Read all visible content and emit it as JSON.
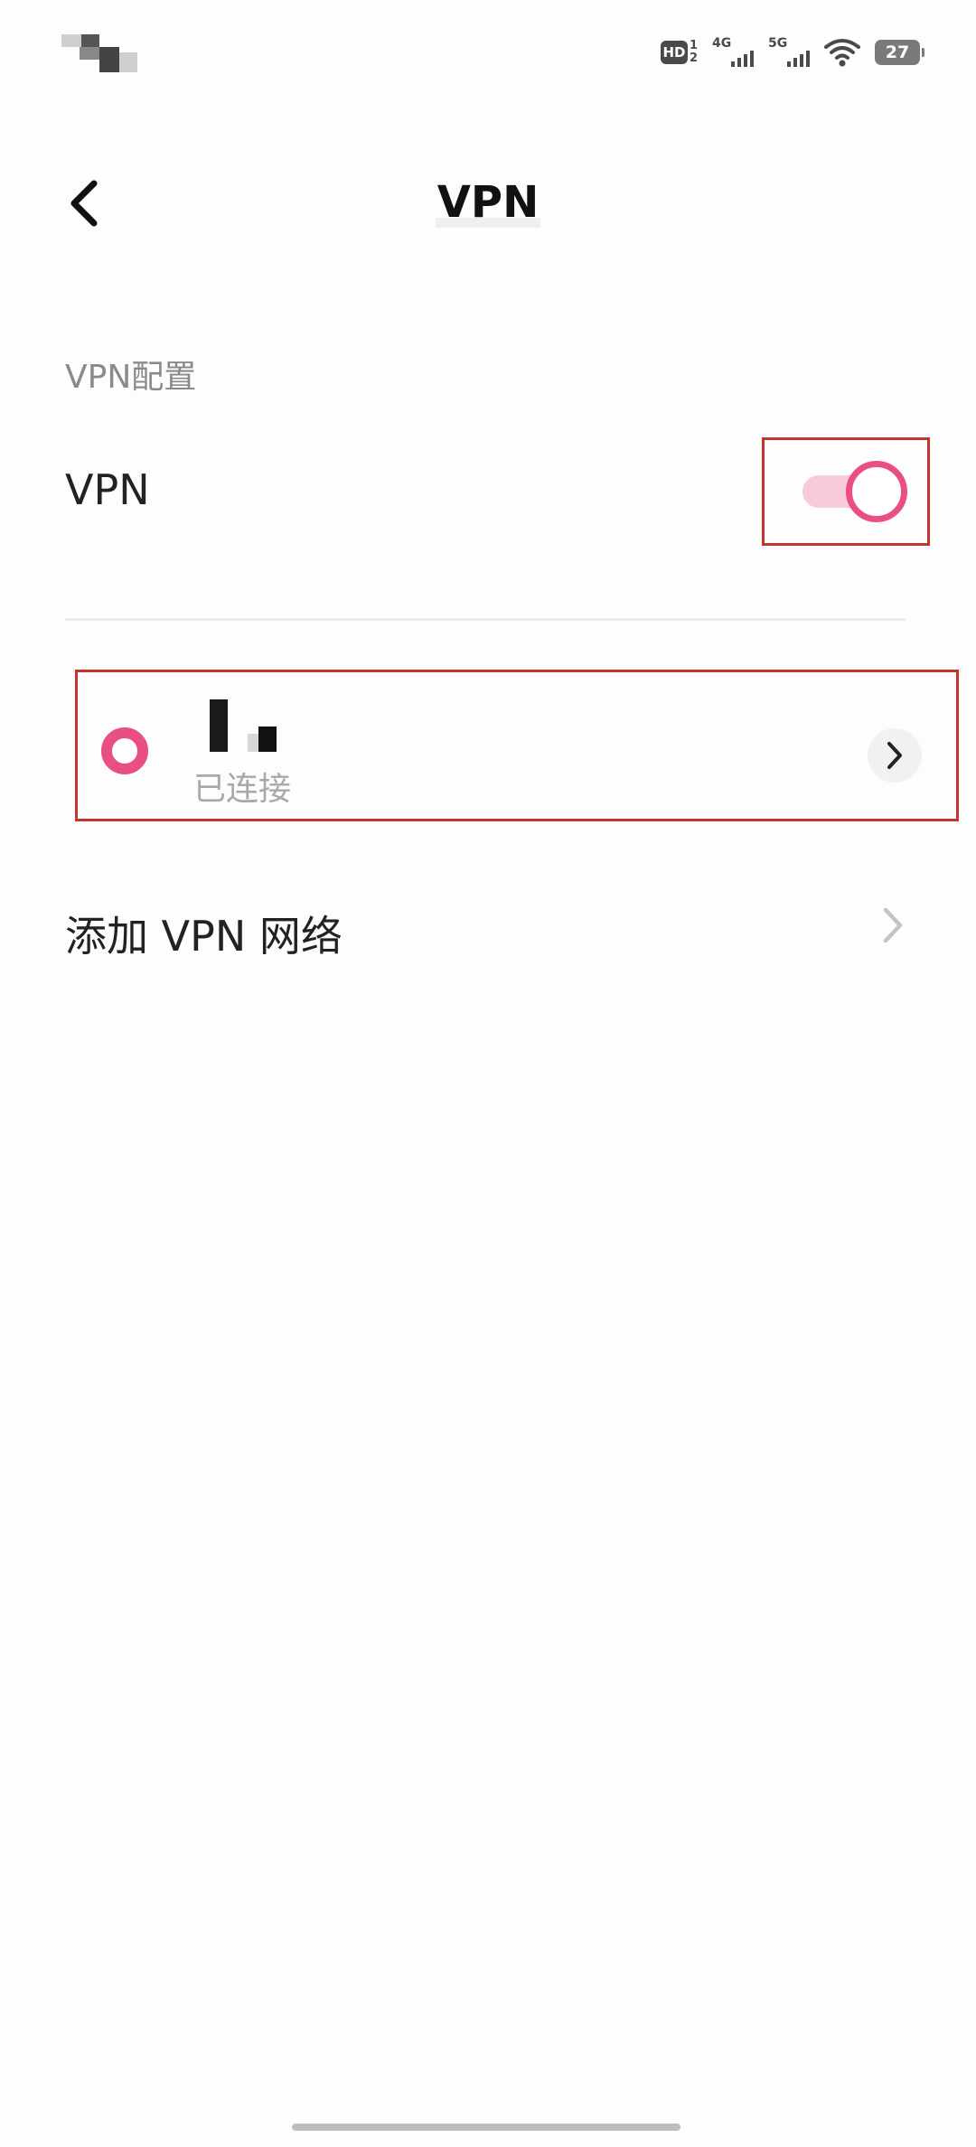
{
  "status_bar": {
    "hd_label": "HD",
    "hd_sim_1": "1",
    "hd_sim_2": "2",
    "signal_1_label": "4G",
    "signal_2_label": "5G",
    "battery_level": "27"
  },
  "header": {
    "title": "VPN",
    "back_icon": "chevron-left-icon"
  },
  "vpn_config": {
    "section_label": "VPN配置",
    "vpn_toggle_label": "VPN",
    "vpn_toggle_on": true
  },
  "vpn_profiles": [
    {
      "name": "",
      "status": "已连接",
      "selected": true,
      "detail_icon": "chevron-right-icon"
    }
  ],
  "add_network": {
    "label": "添加 VPN 网络",
    "chevron_icon": "chevron-right-icon"
  },
  "colors": {
    "accent": "#e94f84",
    "accent_light": "#f8cbd8",
    "highlight_border": "#c8352c"
  }
}
